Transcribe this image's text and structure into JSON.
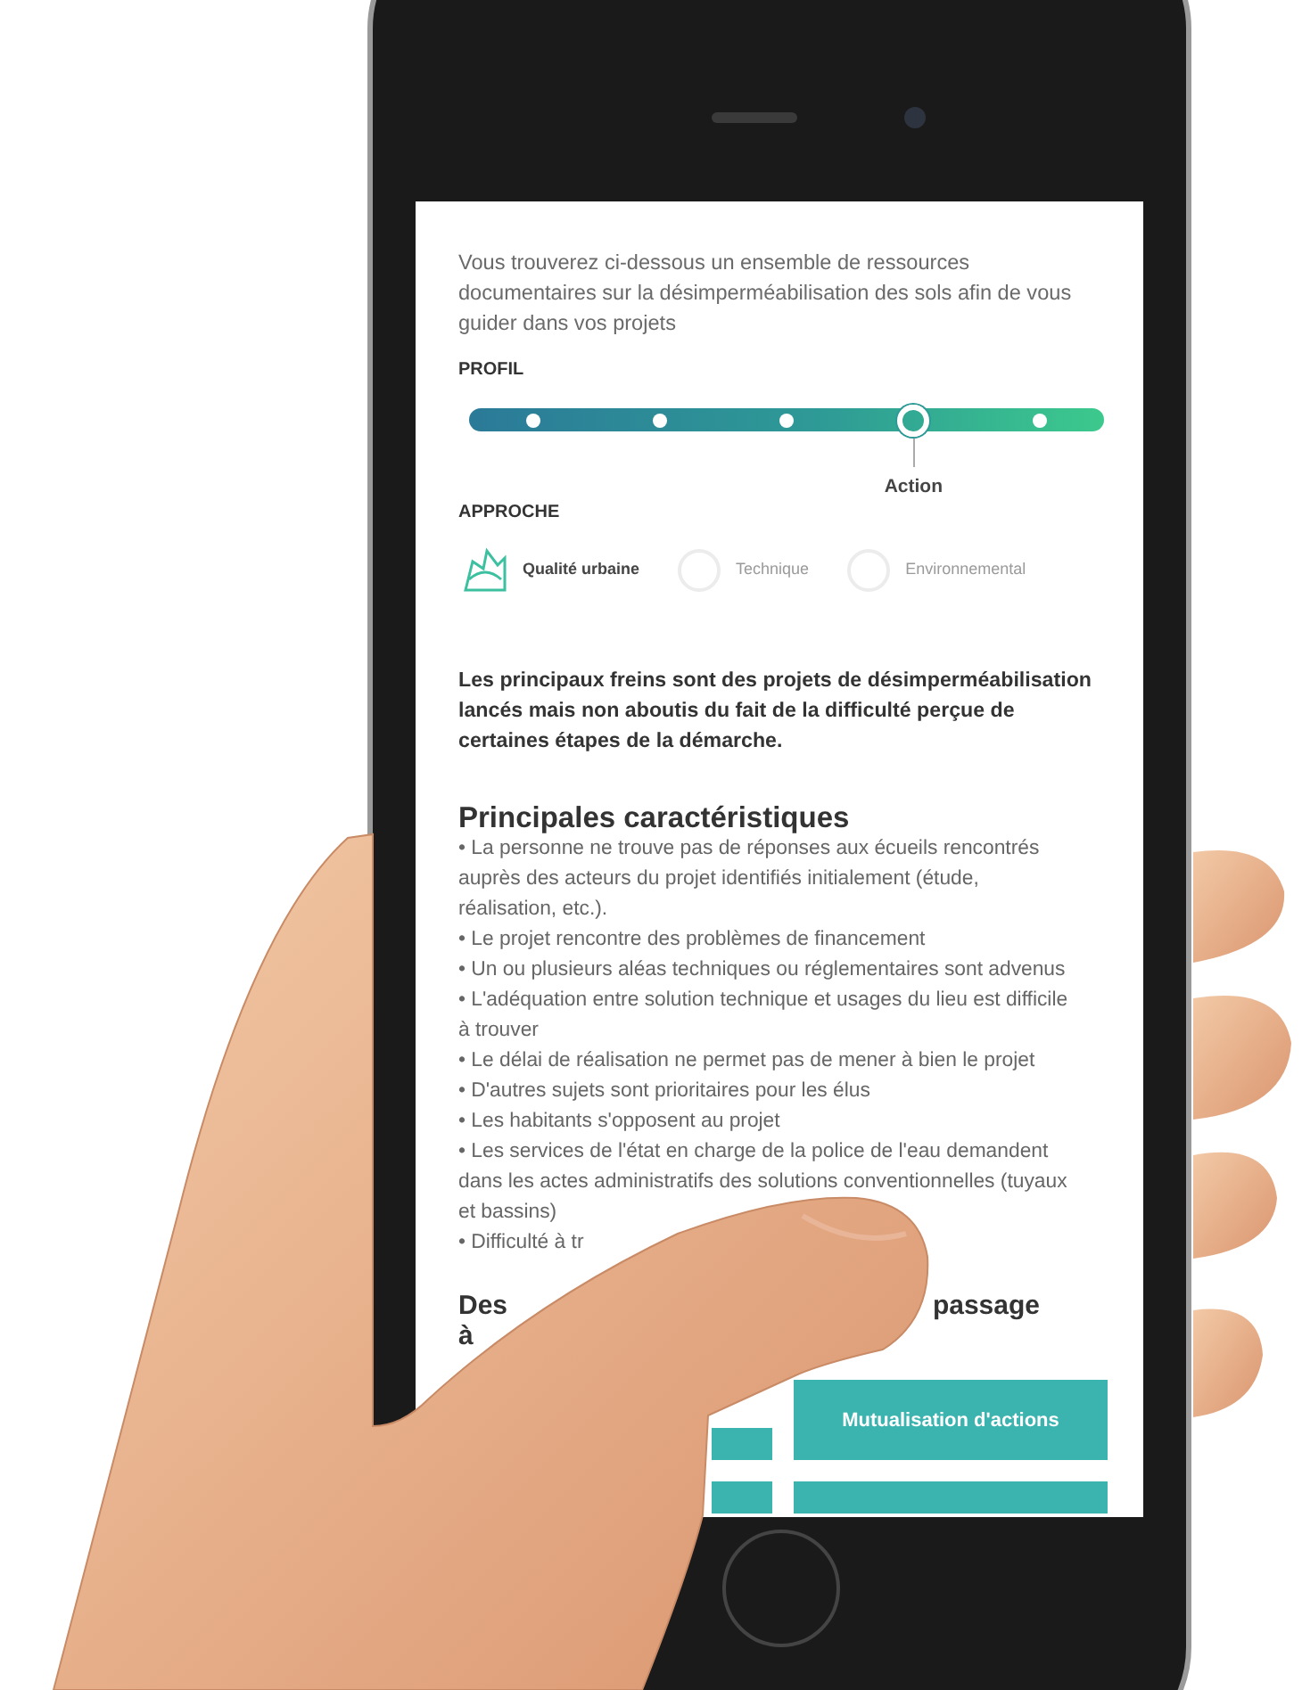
{
  "intro": "Vous trouverez ci-dessous un ensemble de ressources documentaires sur la désimperméabilisation des sols afin de vous guider dans vos projets",
  "profile": {
    "title": "PROFIL",
    "steps": [
      {
        "selected": false
      },
      {
        "selected": false
      },
      {
        "selected": false
      },
      {
        "selected": true,
        "label": "Action"
      },
      {
        "selected": false
      }
    ]
  },
  "approach": {
    "title": "APPROCHE",
    "items": [
      {
        "label": "Qualité urbaine",
        "selected": true
      },
      {
        "label": "Technique",
        "selected": false
      },
      {
        "label": "Environnemental",
        "selected": false
      }
    ]
  },
  "summary": "Les principaux freins sont des projets de désimperméabilisation lancés mais non aboutis du fait de la difficulté perçue de certaines étapes de la démarche.",
  "characteristics": {
    "title": "Principales caractéristiques",
    "items": [
      "• La personne ne trouve pas de réponses aux écueils rencontrés auprès des acteurs du projet identifiés initialement (étude, réalisation, etc.).",
      "• Le projet rencontre des problèmes de financement",
      "• Un ou plusieurs aléas techniques ou réglementaires sont advenus",
      "• L'adéquation entre solution technique et usages du lieu est difficile à trouver",
      "• Le délai de réalisation ne permet pas de mener à bien le projet",
      "• D'autres sujets sont prioritaires pour les élus",
      "• Les habitants s'opposent au projet",
      "• Les services de l'état en charge de la police de l'eau demandent dans les actes administratifs des solutions conventionnelles (tuyaux et bassins)",
      "• Difficulté à tr"
    ]
  },
  "heading_fragments": [
    "Des",
    "passage",
    "à"
  ],
  "action_buttons": [
    {
      "kind": "covered"
    },
    {
      "kind": "label",
      "label": "Mutualisation d'actions"
    },
    {
      "kind": "cut_covered"
    },
    {
      "kind": "cut"
    }
  ]
}
